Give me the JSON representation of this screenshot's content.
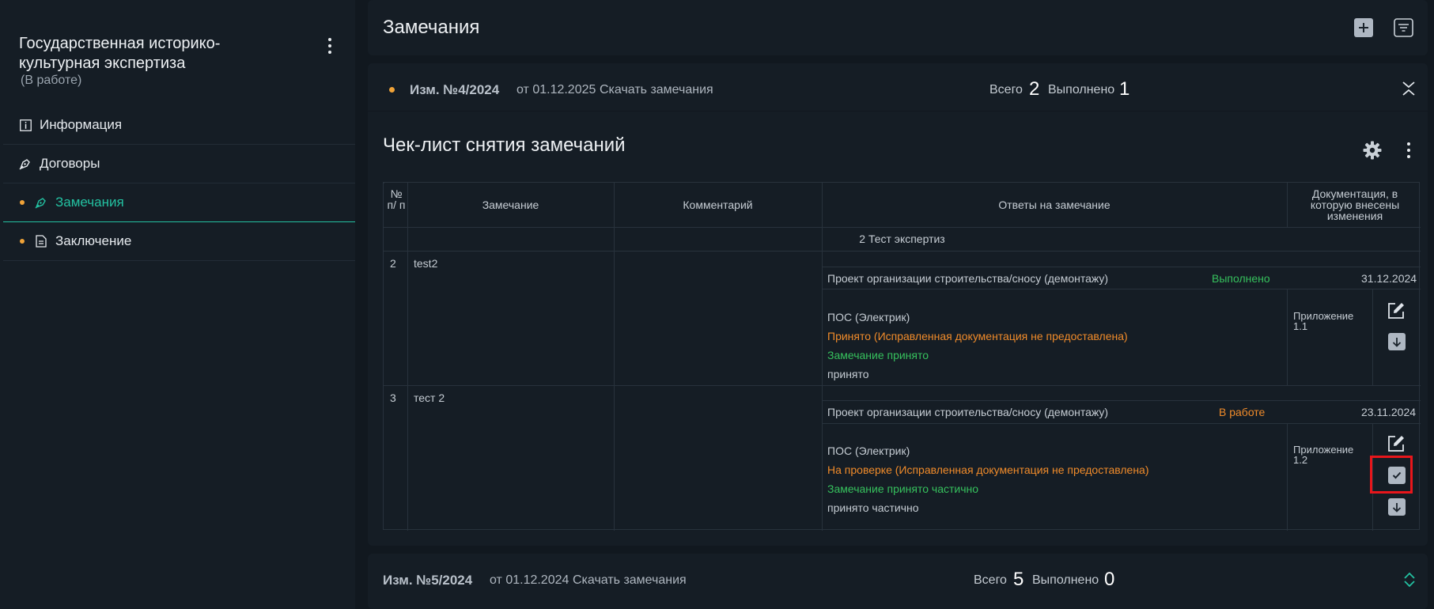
{
  "sidebar": {
    "project_title": "Государственная историко-культурная экспертиза",
    "project_status": "(В работе)",
    "items": [
      {
        "label": "Информация",
        "icon": "info-icon"
      },
      {
        "label": "Договоры",
        "icon": "pen-icon"
      },
      {
        "label": "Замечания",
        "icon": "pen-icon",
        "active": true
      },
      {
        "label": "Заключение",
        "icon": "document-icon"
      }
    ]
  },
  "header": {
    "title": "Замечания"
  },
  "revision_open": {
    "name": "Изм. №4/2024",
    "date": "от 01.12.2025",
    "download": "Скачать замечания",
    "total_label": "Всего",
    "total": "2",
    "done_label": "Выполнено",
    "done": "1"
  },
  "checklist": {
    "title": "Чек-лист снятия замечаний",
    "columns": [
      "№ п/ п",
      "Замечание",
      "Комментарий",
      "Ответы на замечание",
      "Документация, в которую внесены изменения"
    ],
    "group": "2 Тест экспертиз",
    "rows": [
      {
        "num": "2",
        "remark": "test2",
        "section": "Проект организации строительства/сносу (демонтажу)",
        "section_status": "Выполнено",
        "section_date": "31.12.2024",
        "sub": "ПОС (Электрик)",
        "state": "Принято (Исправленная документация не предоставлена)",
        "verdict": "Замечание принято",
        "note": "принято",
        "doc": "Приложение 1.1"
      },
      {
        "num": "3",
        "remark": "тест 2",
        "section": "Проект организации строительства/сносу (демонтажу)",
        "section_status": "В работе",
        "section_date": "23.11.2024",
        "sub": "ПОС (Электрик)",
        "state": "На проверке (Исправленная документация не предоставлена)",
        "verdict": "Замечание принято частично",
        "note": "принято частично",
        "doc": "Приложение 1.2"
      }
    ]
  },
  "revision_collapsed": {
    "name": "Изм. №5/2024",
    "date": "от 01.12.2024",
    "download": "Скачать замечания",
    "total_label": "Всего",
    "total": "5",
    "done_label": "Выполнено",
    "done": "0"
  },
  "colors": {
    "accent": "#23c1a1",
    "orange": "#f08b2a",
    "green": "#36c15d",
    "highlight": "#e8161b"
  }
}
